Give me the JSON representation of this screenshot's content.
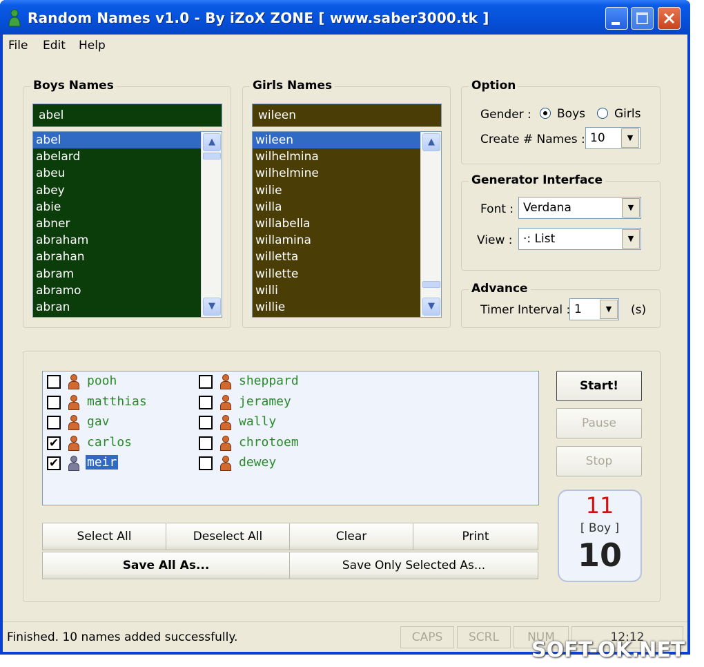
{
  "window": {
    "title": "Random Names v1.0 - By iZoX ZONE [ www.saber3000.tk ]"
  },
  "menu": [
    "File",
    "Edit",
    "Help"
  ],
  "boys": {
    "legend": "Boys Names",
    "input_value": "abel",
    "items": [
      "abel",
      "abelard",
      "abeu",
      "abey",
      "abie",
      "abner",
      "abraham",
      "abrahan",
      "abram",
      "abramo",
      "abran"
    ],
    "selected_index": 0,
    "color": "#0b3d0b"
  },
  "girls": {
    "legend": "Girls Names",
    "input_value": "wileen",
    "items": [
      "wileen",
      "wilhelmina",
      "wilhelmine",
      "wilie",
      "willa",
      "willabella",
      "willamina",
      "willetta",
      "willette",
      "willi",
      "willie"
    ],
    "selected_index": 0,
    "color": "#4a3d06"
  },
  "option": {
    "legend": "Option",
    "gender_label": "Gender :",
    "gender_boys": "Boys",
    "gender_girls": "Girls",
    "gender_selected": "Boys",
    "create_label": "Create # Names :",
    "create_value": "10"
  },
  "generator": {
    "legend": "Generator Interface",
    "font_label": "Font :",
    "font_value": "Verdana",
    "view_label": "View :",
    "view_value": "·: List"
  },
  "advance": {
    "legend": "Advance",
    "timer_label": "Timer Interval :",
    "timer_value": "1",
    "timer_unit": "(s)"
  },
  "output": {
    "col1": [
      {
        "name": "pooh",
        "checked": false,
        "selected": false
      },
      {
        "name": "matthias",
        "checked": false,
        "selected": false
      },
      {
        "name": "gav",
        "checked": false,
        "selected": false
      },
      {
        "name": "carlos",
        "checked": true,
        "selected": false
      },
      {
        "name": "meir",
        "checked": true,
        "selected": true
      }
    ],
    "col2": [
      {
        "name": "sheppard",
        "checked": false,
        "selected": false
      },
      {
        "name": "jeramey",
        "checked": false,
        "selected": false
      },
      {
        "name": "wally",
        "checked": false,
        "selected": false
      },
      {
        "name": "chrotoem",
        "checked": false,
        "selected": false
      },
      {
        "name": "dewey",
        "checked": false,
        "selected": false
      }
    ]
  },
  "buttons": {
    "select_all": "Select All",
    "deselect_all": "Deselect All",
    "clear": "Clear",
    "print": "Print",
    "save_all": "Save All As...",
    "save_selected": "Save Only Selected As...",
    "start": "Start!",
    "pause": "Pause",
    "stop": "Stop"
  },
  "counter": {
    "top": "11",
    "mid": "[ Boy ]",
    "bottom": "10"
  },
  "status": {
    "message": "Finished. 10 names added successfully.",
    "caps": "CAPS",
    "scrl": "SCRL",
    "num": "NUM",
    "time": "12:12"
  },
  "watermark": "SOFT-OK.NET"
}
